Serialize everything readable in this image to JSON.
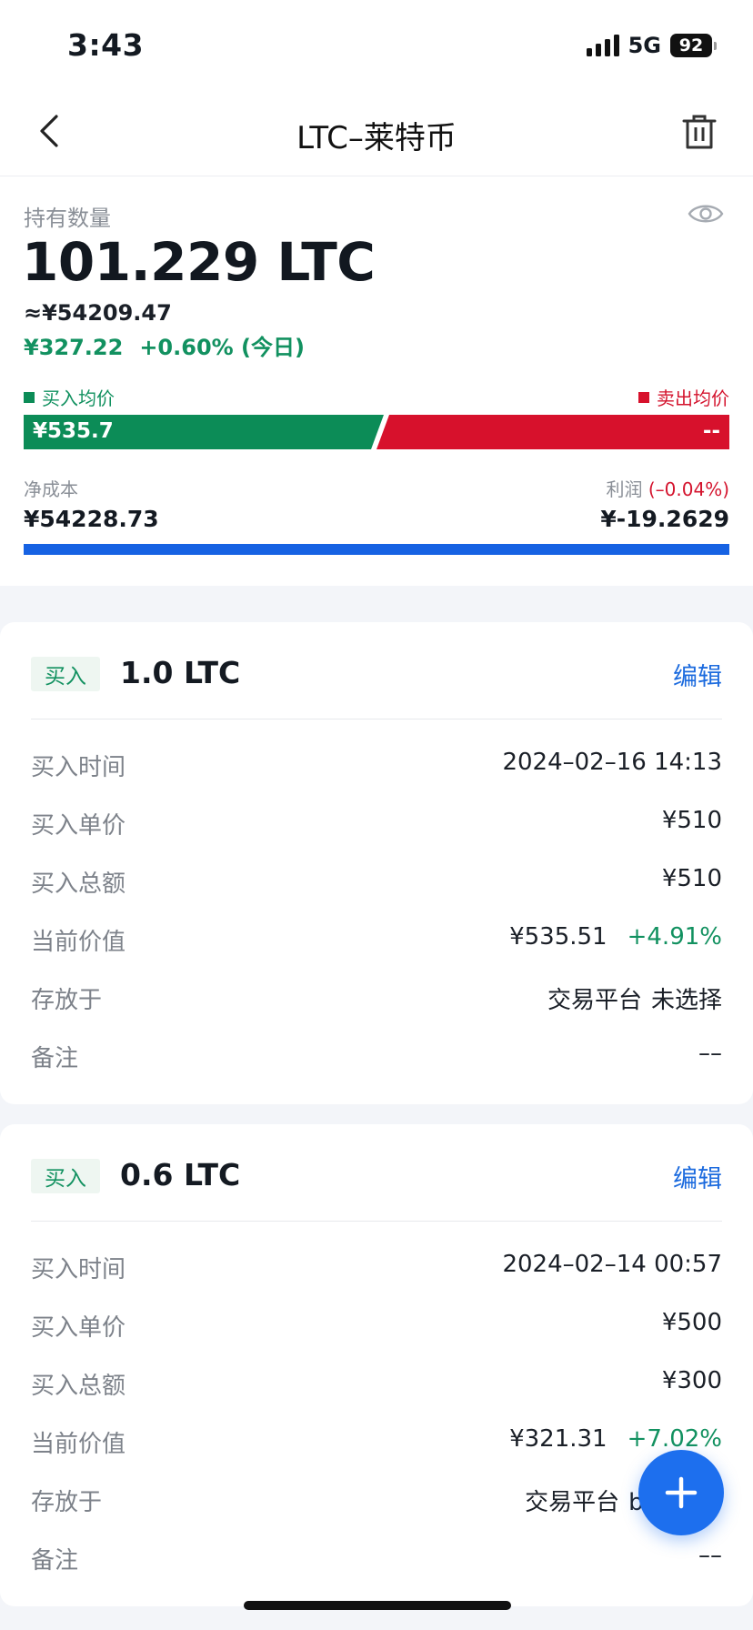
{
  "status_bar": {
    "time": "3:43",
    "network": "5G",
    "battery": "92"
  },
  "nav": {
    "title": "LTC–莱特币"
  },
  "summary": {
    "hold_label": "持有数量",
    "hold_amount": "101.229 LTC",
    "hold_cny": "≈¥54209.47",
    "day_change_amount": "¥327.22",
    "day_change_pct": "+0.60% (今日)",
    "buy_avg_label": "买入均价",
    "sell_avg_label": "卖出均价",
    "buy_avg_value": "¥535.7",
    "sell_avg_value": "--",
    "net_cost_label": "净成本",
    "net_cost_value": "¥54228.73",
    "profit_label": "利润",
    "profit_pct": "(–0.04%)",
    "profit_value": "¥-19.2629"
  },
  "trades": [
    {
      "type": "买入",
      "amount": "1.0 LTC",
      "edit": "编辑",
      "rows": [
        {
          "label": "买入时间",
          "value": "2024–02–16 14:13"
        },
        {
          "label": "买入单价",
          "value": "¥510"
        },
        {
          "label": "买入总额",
          "value": "¥510"
        },
        {
          "label": "当前价值",
          "value": "¥535.51",
          "change": "+4.91%"
        },
        {
          "label": "存放于",
          "value": "交易平台",
          "value2": "未选择"
        },
        {
          "label": "备注",
          "value": "––"
        }
      ]
    },
    {
      "type": "买入",
      "amount": "0.6 LTC",
      "edit": "编辑",
      "rows": [
        {
          "label": "买入时间",
          "value": "2024–02–14 00:57"
        },
        {
          "label": "买入单价",
          "value": "¥500"
        },
        {
          "label": "买入总额",
          "value": "¥300"
        },
        {
          "label": "当前价值",
          "value": "¥321.31",
          "change": "+7.02%"
        },
        {
          "label": "存放于",
          "value": "交易平台",
          "value2": "binance"
        },
        {
          "label": "备注",
          "value": "––"
        }
      ]
    }
  ],
  "colors": {
    "green": "#129160",
    "red": "#d4142e",
    "blue": "#1c6bde"
  }
}
